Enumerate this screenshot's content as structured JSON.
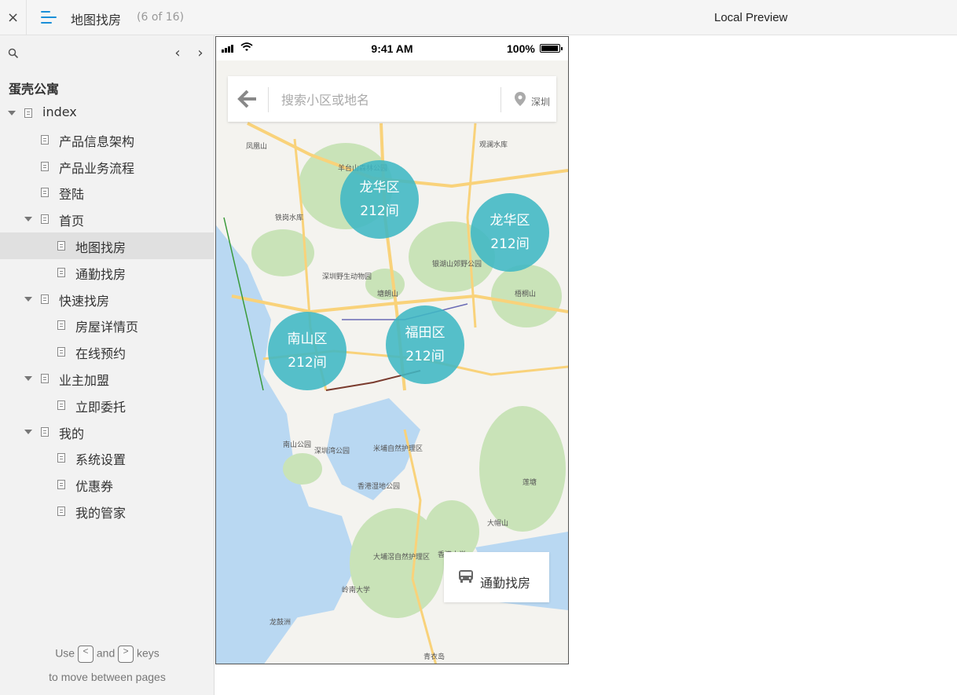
{
  "topbar": {
    "close_glyph": "×",
    "page_title": "地图找房",
    "page_count": "(6 of 16)",
    "preview_label": "Local Preview"
  },
  "sidebar": {
    "project_title": "蛋壳公寓",
    "prev_glyph": "‹",
    "next_glyph": "›",
    "items": [
      {
        "label": "index",
        "level": 0,
        "expanded": true,
        "selected": false
      },
      {
        "label": "产品信息架构",
        "level": 1,
        "expanded": false,
        "selected": false
      },
      {
        "label": "产品业务流程",
        "level": 1,
        "expanded": false,
        "selected": false
      },
      {
        "label": "登陆",
        "level": 1,
        "expanded": false,
        "selected": false
      },
      {
        "label": "首页",
        "level": 1,
        "expanded": true,
        "selected": false
      },
      {
        "label": "地图找房",
        "level": 2,
        "expanded": false,
        "selected": true
      },
      {
        "label": "通勤找房",
        "level": 2,
        "expanded": false,
        "selected": false
      },
      {
        "label": "快速找房",
        "level": 1,
        "expanded": true,
        "selected": false
      },
      {
        "label": "房屋详情页",
        "level": 2,
        "expanded": false,
        "selected": false
      },
      {
        "label": "在线预约",
        "level": 2,
        "expanded": false,
        "selected": false
      },
      {
        "label": "业主加盟",
        "level": 1,
        "expanded": true,
        "selected": false
      },
      {
        "label": "立即委托",
        "level": 2,
        "expanded": false,
        "selected": false
      },
      {
        "label": "我的",
        "level": 1,
        "expanded": true,
        "selected": false
      },
      {
        "label": "系统设置",
        "level": 2,
        "expanded": false,
        "selected": false
      },
      {
        "label": "优惠券",
        "level": 2,
        "expanded": false,
        "selected": false
      },
      {
        "label": "我的管家",
        "level": 2,
        "expanded": false,
        "selected": false
      }
    ],
    "hint": {
      "use": "Use",
      "key_prev": "<",
      "and": "and",
      "key_next": ">",
      "keys": "keys",
      "line2": "to move between pages"
    }
  },
  "phone": {
    "status": {
      "time": "9:41 AM",
      "battery": "100%"
    },
    "search": {
      "placeholder": "搜索小区或地名",
      "city": "深圳"
    },
    "bubbles": [
      {
        "name": "龙华区",
        "count": "212间"
      },
      {
        "name": "龙华区",
        "count": "212间"
      },
      {
        "name": "南山区",
        "count": "212间"
      },
      {
        "name": "福田区",
        "count": "212间"
      }
    ],
    "commute_label": "通勤找房",
    "map_labels": [
      "凤凰山",
      "羊台山森林公园",
      "铁岗水库",
      "观澜水库",
      "深圳野生动物园",
      "塘朗山",
      "银湖山郊野公园",
      "梧桐山",
      "深圳湾公园",
      "南山公园",
      "米埔自然护理区",
      "香港湿地公园",
      "大埔滘自然护理区",
      "香港大学",
      "岭南大学",
      "大帽山",
      "莲塘",
      "龙鼓洲",
      "青衣岛"
    ],
    "colors": {
      "bubble": "#3fb7c4",
      "water": "#b9d8f2",
      "park": "#c9e3b8",
      "road": "#f9d27a"
    }
  }
}
